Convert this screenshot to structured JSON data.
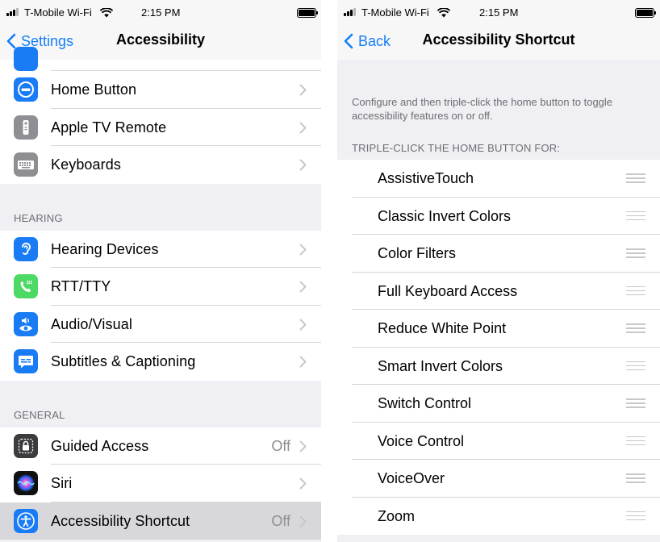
{
  "left": {
    "status_bar": {
      "carrier": "T-Mobile Wi-Fi",
      "time": "2:15 PM"
    },
    "nav": {
      "back_label": "Settings",
      "title": "Accessibility"
    },
    "groups": [
      {
        "header": "",
        "items": [
          {
            "label": "Home Button",
            "value": "",
            "icon": "home-button-icon",
            "icon_color": "#1a7cf5"
          },
          {
            "label": "Apple TV Remote",
            "value": "",
            "icon": "tv-remote-icon",
            "icon_color": "#8e8e93"
          },
          {
            "label": "Keyboards",
            "value": "",
            "icon": "keyboard-icon",
            "icon_color": "#8e8e93"
          }
        ]
      },
      {
        "header": "HEARING",
        "items": [
          {
            "label": "Hearing Devices",
            "value": "",
            "icon": "ear-icon",
            "icon_color": "#1a7cf5"
          },
          {
            "label": "RTT/TTY",
            "value": "",
            "icon": "rtt-tty-icon",
            "icon_color": "#4cd964"
          },
          {
            "label": "Audio/Visual",
            "value": "",
            "icon": "audio-visual-icon",
            "icon_color": "#1a7cf5"
          },
          {
            "label": "Subtitles & Captioning",
            "value": "",
            "icon": "captioning-icon",
            "icon_color": "#1a7cf5"
          }
        ]
      },
      {
        "header": "GENERAL",
        "items": [
          {
            "label": "Guided Access",
            "value": "Off",
            "icon": "guided-access-icon",
            "icon_color": "#3c3c3e"
          },
          {
            "label": "Siri",
            "value": "",
            "icon": "siri-icon",
            "icon_color": "#111111"
          },
          {
            "label": "Accessibility Shortcut",
            "value": "Off",
            "icon": "accessibility-icon",
            "icon_color": "#1a7cf5",
            "highlighted": true
          }
        ]
      }
    ]
  },
  "right": {
    "status_bar": {
      "carrier": "T-Mobile Wi-Fi",
      "time": "2:15 PM"
    },
    "nav": {
      "back_label": "Back",
      "title": "Accessibility Shortcut"
    },
    "description": "Configure and then triple-click the home button to toggle accessibility features on or off.",
    "section_header": "TRIPLE-CLICK THE HOME BUTTON FOR:",
    "options": [
      "AssistiveTouch",
      "Classic Invert Colors",
      "Color Filters",
      "Full Keyboard Access",
      "Reduce White Point",
      "Smart Invert Colors",
      "Switch Control",
      "Voice Control",
      "VoiceOver",
      "Zoom"
    ]
  },
  "colors": {
    "accent": "#147efb",
    "background": "#efeff4",
    "secondary_text": "#6d6d72"
  }
}
